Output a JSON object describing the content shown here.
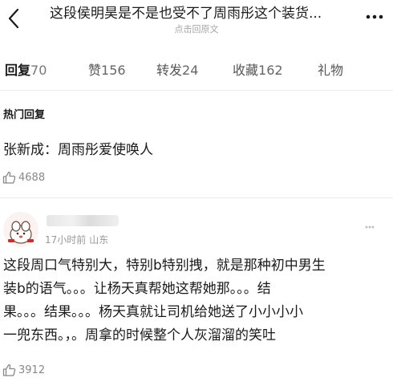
{
  "header": {
    "title": "这段侯明昊是不是也受不了周雨彤这个装货...",
    "subtitle": "点击回原文",
    "back_icon": "chevron-left-icon",
    "more_icon": "more-dots-icon"
  },
  "tabs": [
    {
      "label": "回复",
      "count": "70",
      "active": true
    },
    {
      "label": "赞",
      "count": "156",
      "active": false
    },
    {
      "label": "转发",
      "count": "24",
      "active": false
    },
    {
      "label": "收藏",
      "count": "162",
      "active": false
    },
    {
      "label": "礼物",
      "count": "",
      "active": false
    }
  ],
  "section": {
    "title": "热门回复"
  },
  "comments": [
    {
      "text": "张新成：周雨彤爱使唤人",
      "likes": "4688",
      "like_icon": "thumb-up-icon"
    },
    {
      "time": "17小时前",
      "location": "山东",
      "lines": [
        "这段周口气特别大，特别b特别拽，就是那种初中男生",
        "装b的语气。。。让杨天真帮她这帮她那。。。结",
        "果。。。结果。。。杨天真就让司机给她送了小小小小",
        "一兜东西。，。周拿的时候整个人灰溜溜的笑吐"
      ],
      "likes": "3912",
      "like_icon": "thumb-up-icon",
      "avatar_icon": "cartoon-avatar-icon"
    }
  ],
  "colors": {
    "text": "#1a1a1a",
    "muted": "#999999",
    "divider": "#ececec"
  }
}
